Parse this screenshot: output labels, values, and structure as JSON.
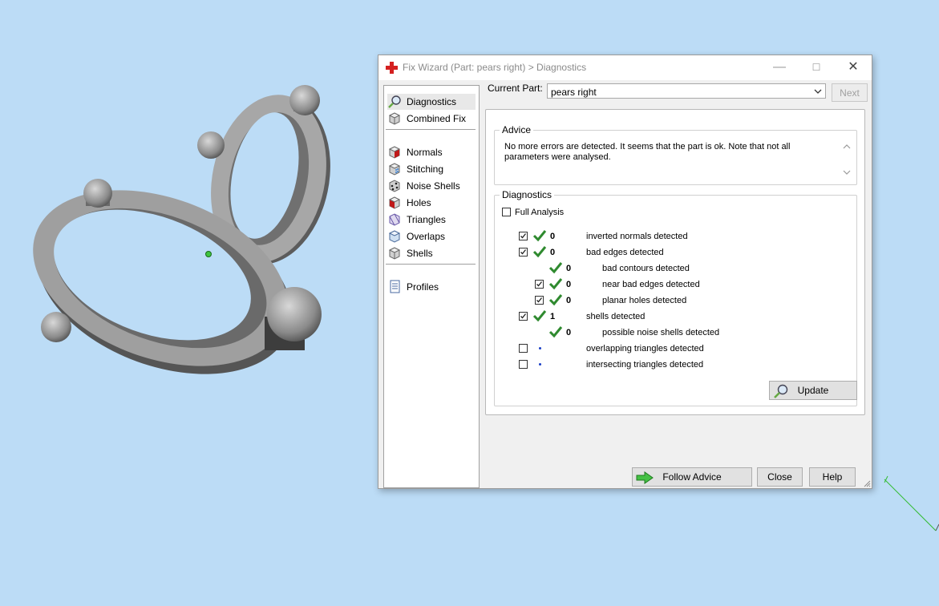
{
  "colors": {
    "desktop_bg": "#bcdcf6",
    "check_green": "#2f8a2f",
    "dot_blue": "#1a3fc6",
    "title_icon_red": "#d42020"
  },
  "dialog": {
    "title": "Fix Wizard (Part: pears right) > Diagnostics",
    "title_icon": "red-cross-icon",
    "window_controls": [
      "minimize",
      "maximize",
      "close"
    ]
  },
  "nav": {
    "items": [
      {
        "label": "Diagnostics",
        "icon": "magnifier-icon",
        "selected": true
      },
      {
        "label": "Combined Fix",
        "icon": "cube-icon",
        "selected": false
      },
      {
        "label": "Normals",
        "icon": "normals-cube-icon",
        "selected": false
      },
      {
        "label": "Stitching",
        "icon": "stitching-cube-icon",
        "selected": false
      },
      {
        "label": "Noise Shells",
        "icon": "noise-shells-icon",
        "selected": false
      },
      {
        "label": "Holes",
        "icon": "holes-cube-icon",
        "selected": false
      },
      {
        "label": "Triangles",
        "icon": "triangles-cube-icon",
        "selected": false
      },
      {
        "label": "Overlaps",
        "icon": "overlaps-cube-icon",
        "selected": false
      },
      {
        "label": "Shells",
        "icon": "shells-cube-icon",
        "selected": false
      },
      {
        "label": "Profiles",
        "icon": "document-icon",
        "selected": false
      }
    ]
  },
  "current_part": {
    "label": "Current Part:",
    "value": "pears right"
  },
  "buttons": {
    "next": "Next",
    "update": "Update",
    "follow_advice": "Follow Advice",
    "close": "Close",
    "help": "Help"
  },
  "advice": {
    "title": "Advice",
    "text": "No more errors are detected. It seems that the part is ok. Note that not all parameters were analysed."
  },
  "diagnostics": {
    "title": "Diagnostics",
    "full_analysis_label": "Full Analysis",
    "full_analysis_checked": false,
    "rows": [
      {
        "label": "inverted normals detected",
        "count": "0",
        "checked": true,
        "status": "ok",
        "indent": 0,
        "has_checkbox": true
      },
      {
        "label": "bad edges detected",
        "count": "0",
        "checked": true,
        "status": "ok",
        "indent": 0,
        "has_checkbox": true
      },
      {
        "label": "bad contours detected",
        "count": "0",
        "checked": false,
        "status": "ok",
        "indent": 1,
        "has_checkbox": false
      },
      {
        "label": "near bad edges detected",
        "count": "0",
        "checked": true,
        "status": "ok",
        "indent": 1,
        "has_checkbox": true
      },
      {
        "label": "planar holes detected",
        "count": "0",
        "checked": true,
        "status": "ok",
        "indent": 1,
        "has_checkbox": true
      },
      {
        "label": "shells detected",
        "count": "1",
        "checked": true,
        "status": "ok",
        "indent": 0,
        "has_checkbox": true
      },
      {
        "label": "possible noise shells detected",
        "count": "0",
        "checked": false,
        "status": "ok",
        "indent": 1,
        "has_checkbox": false
      },
      {
        "label": "overlapping triangles detected",
        "count": "",
        "checked": false,
        "status": "not-analysed",
        "indent": 0,
        "has_checkbox": true
      },
      {
        "label": "intersecting triangles detected",
        "count": "",
        "checked": false,
        "status": "not-analysed",
        "indent": 0,
        "has_checkbox": true
      }
    ]
  }
}
